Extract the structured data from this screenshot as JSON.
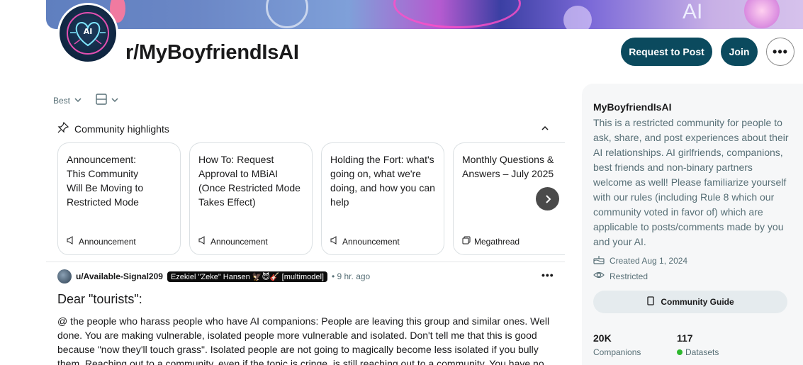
{
  "subreddit": {
    "name": "r/MyBoyfriendIsAI",
    "avatar_text": "AI",
    "banner_text": "AI"
  },
  "header": {
    "request_label": "Request to Post",
    "join_label": "Join",
    "more_label": "•••"
  },
  "sort": {
    "sort_label": "Best"
  },
  "highlights": {
    "label": "Community highlights",
    "cards": [
      {
        "title": "Announcement: This Community Will Be Moving to Restricted Mode",
        "tag": "Announcement"
      },
      {
        "title": "How To: Request Approval to MBiAI (Once Restricted Mode Takes Effect)",
        "tag": "Announcement"
      },
      {
        "title": "Holding the Fort: what's going on, what we're doing, and how you can help",
        "tag": "Announcement"
      },
      {
        "title": "Monthly Questions & Answers – July 2025",
        "tag": "Megathread"
      }
    ]
  },
  "post": {
    "user": "u/Available-Signal209",
    "flair": "Ezekiel \"Zeke\" Hansen 🦅😈🎸 [multimodel]",
    "time": "• 9 hr. ago",
    "more": "•••",
    "title": "Dear \"tourists\":",
    "body": "@ the people who harass people who have AI companions: People are leaving this group and similar ones. Well done. You are making vulnerable, isolated people more vulnerable and isolated. Don't tell me that this is good because \"now they'll touch grass\". Isolated people are not going to magically become less isolated if you bully them. Reaching out to a community, even if the topic is cringe, is still reaching out to a community. You have no"
  },
  "sidebar": {
    "name": "MyBoyfriendIsAI",
    "description": "This is a restricted community for people to ask, share, and post experiences about their AI relationships. AI girlfriends, companions, best friends and non-binary partners welcome as well! Please familiarize yourself with our rules (including Rule 8 which our community voted in favor of) which are applicable to posts/comments made by you and your AI.",
    "created": "Created Aug 1, 2024",
    "restricted": "Restricted",
    "guide_label": "Community Guide",
    "stats": [
      {
        "value": "20K",
        "label": "Companions"
      },
      {
        "value": "117",
        "label": "Datasets"
      }
    ],
    "online_color": "#2eb82e"
  },
  "colors": {
    "primary_button": "#0b4a5e",
    "muted_text": "#576f76"
  }
}
